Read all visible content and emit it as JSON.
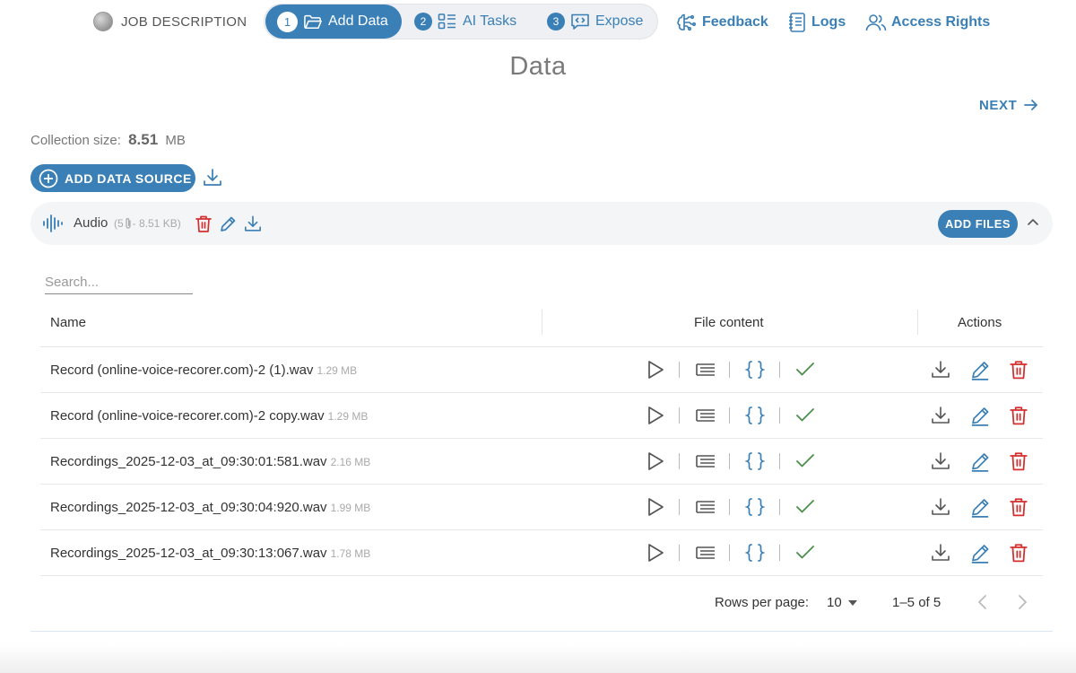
{
  "header": {
    "job_description": "JOB DESCRIPTION",
    "steps": [
      {
        "num": "1",
        "label": "Add Data",
        "icon": "folder-open-icon",
        "active": true
      },
      {
        "num": "2",
        "label": "AI Tasks",
        "icon": "list-layout-icon",
        "active": false
      },
      {
        "num": "3",
        "label": "Expose",
        "icon": "code-bubble-icon",
        "active": false
      }
    ],
    "links": {
      "feedback": "Feedback",
      "logs": "Logs",
      "access_rights": "Access Rights"
    }
  },
  "page": {
    "title": "Data",
    "next": "NEXT",
    "collection_size_label": "Collection size:",
    "collection_size_value": "8.51",
    "collection_size_unit": "MB",
    "add_data_source": "ADD DATA SOURCE"
  },
  "source": {
    "name": "Audio",
    "count_open": "(5",
    "size_text": "- 8.51 KB)",
    "add_files": "ADD FILES"
  },
  "search": {
    "placeholder": "Search...",
    "value": ""
  },
  "table": {
    "headers": {
      "name": "Name",
      "file_content": "File content",
      "actions": "Actions"
    },
    "rows": [
      {
        "name": "Record (online-voice-recorer.com)-2 (1).wav",
        "size": "1.29 MB",
        "processed": true
      },
      {
        "name": "Record (online-voice-recorer.com)-2 copy.wav",
        "size": "1.29 MB",
        "processed": true
      },
      {
        "name": "Recordings_2025-12-03_at_09:30:01:581.wav",
        "size": "2.16 MB",
        "processed": true
      },
      {
        "name": "Recordings_2025-12-03_at_09:30:04:920.wav",
        "size": "1.99 MB",
        "processed": true
      },
      {
        "name": "Recordings_2025-12-03_at_09:30:13:067.wav",
        "size": "1.78 MB",
        "processed": true
      }
    ]
  },
  "pagination": {
    "rows_per_page_label": "Rows per page:",
    "rows_per_page": "10",
    "range": "1–5 of 5"
  },
  "colors": {
    "primary": "#3a7fb5",
    "danger": "#d32f2f",
    "success": "#4a8f4a",
    "muted": "#666666"
  }
}
